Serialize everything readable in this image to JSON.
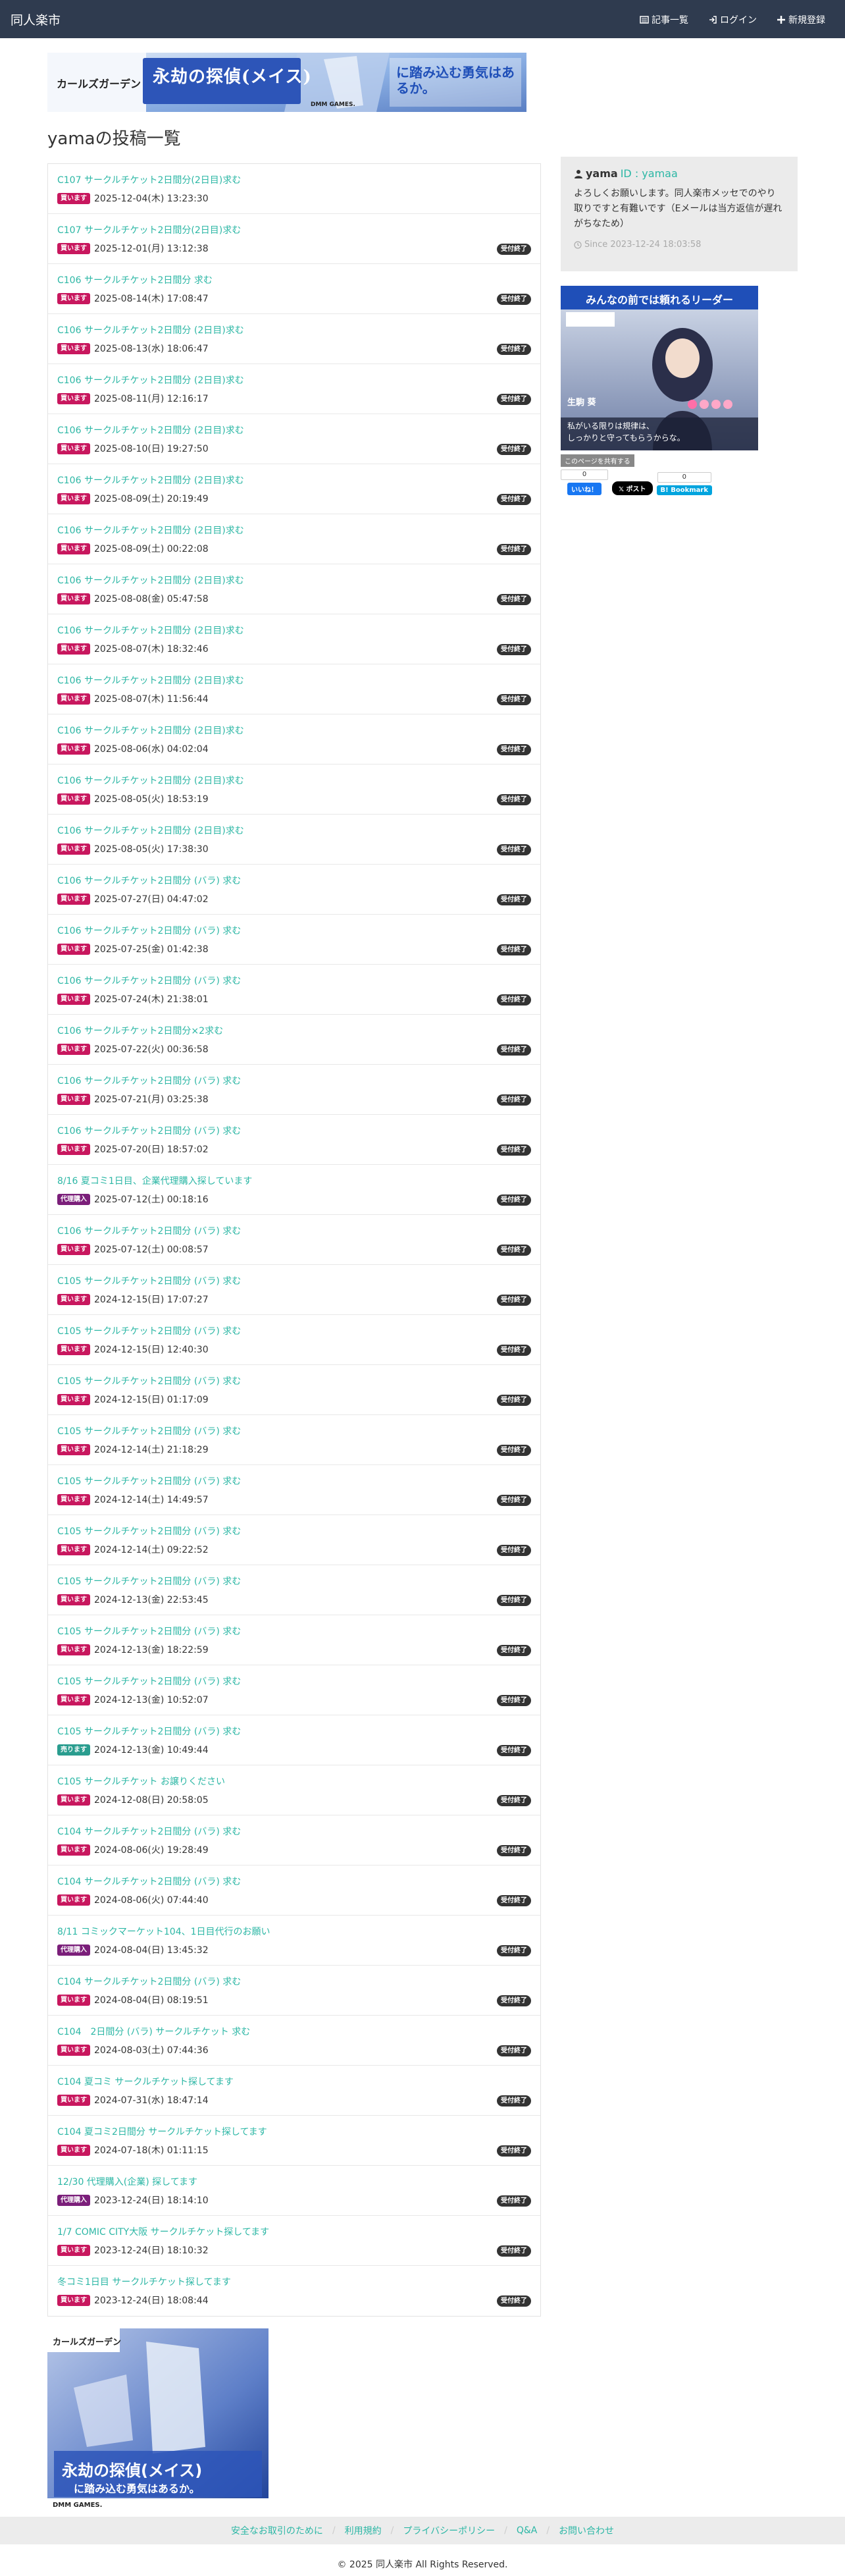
{
  "nav": {
    "brand": "同人楽市",
    "links": [
      {
        "label": "記事一覧",
        "icon": "list-icon"
      },
      {
        "label": "ログイン",
        "icon": "login-icon"
      },
      {
        "label": "新規登録",
        "icon": "plus-icon"
      }
    ]
  },
  "page_title": "yamaの投稿一覧",
  "banner_top": {
    "title_text": "永劫の探偵(メイス)",
    "tagline": "に踏み込む勇気はあるか。",
    "brand": "カールズガーデン",
    "publisher": "DMM GAMES.",
    "colors": {
      "bg": "#7a9fd8",
      "title": "#1f4fb8",
      "logo_bg": "#fff"
    }
  },
  "posts": [
    {
      "title": "C107 サークルチケット2日間分(2日目)求む",
      "type": "買います",
      "date": "2025-12-04(木) 13:23:30",
      "status": ""
    },
    {
      "title": "C107 サークルチケット2日間分(2日目)求む",
      "type": "買います",
      "date": "2025-12-01(月) 13:12:38",
      "status": "受付終了"
    },
    {
      "title": "C106 サークルチケット2日間分 求む",
      "type": "買います",
      "date": "2025-08-14(木) 17:08:47",
      "status": "受付終了"
    },
    {
      "title": "C106 サークルチケット2日間分 (2日目)求む",
      "type": "買います",
      "date": "2025-08-13(水) 18:06:47",
      "status": "受付終了"
    },
    {
      "title": "C106 サークルチケット2日間分 (2日目)求む",
      "type": "買います",
      "date": "2025-08-11(月) 12:16:17",
      "status": "受付終了"
    },
    {
      "title": "C106 サークルチケット2日間分 (2日目)求む",
      "type": "買います",
      "date": "2025-08-10(日) 19:27:50",
      "status": "受付終了"
    },
    {
      "title": "C106 サークルチケット2日間分 (2日目)求む",
      "type": "買います",
      "date": "2025-08-09(土) 20:19:49",
      "status": "受付終了"
    },
    {
      "title": "C106 サークルチケット2日間分 (2日目)求む",
      "type": "買います",
      "date": "2025-08-09(土) 00:22:08",
      "status": "受付終了"
    },
    {
      "title": "C106 サークルチケット2日間分 (2日目)求む",
      "type": "買います",
      "date": "2025-08-08(金) 05:47:58",
      "status": "受付終了"
    },
    {
      "title": "C106 サークルチケット2日間分 (2日目)求む",
      "type": "買います",
      "date": "2025-08-07(木) 18:32:46",
      "status": "受付終了"
    },
    {
      "title": "C106 サークルチケット2日間分 (2日目)求む",
      "type": "買います",
      "date": "2025-08-07(木) 11:56:44",
      "status": "受付終了"
    },
    {
      "title": "C106 サークルチケット2日間分 (2日目)求む",
      "type": "買います",
      "date": "2025-08-06(水) 04:02:04",
      "status": "受付終了"
    },
    {
      "title": "C106 サークルチケット2日間分 (2日目)求む",
      "type": "買います",
      "date": "2025-08-05(火) 18:53:19",
      "status": "受付終了"
    },
    {
      "title": "C106 サークルチケット2日間分 (2日目)求む",
      "type": "買います",
      "date": "2025-08-05(火) 17:38:30",
      "status": "受付終了"
    },
    {
      "title": "C106 サークルチケット2日間分 (バラ) 求む",
      "type": "買います",
      "date": "2025-07-27(日) 04:47:02",
      "status": "受付終了"
    },
    {
      "title": "C106 サークルチケット2日間分 (バラ) 求む",
      "type": "買います",
      "date": "2025-07-25(金) 01:42:38",
      "status": "受付終了"
    },
    {
      "title": "C106 サークルチケット2日間分 (バラ) 求む",
      "type": "買います",
      "date": "2025-07-24(木) 21:38:01",
      "status": "受付終了"
    },
    {
      "title": "C106 サークルチケット2日間分×2求む",
      "type": "買います",
      "date": "2025-07-22(火) 00:36:58",
      "status": "受付終了"
    },
    {
      "title": "C106 サークルチケット2日間分 (バラ) 求む",
      "type": "買います",
      "date": "2025-07-21(月) 03:25:38",
      "status": "受付終了"
    },
    {
      "title": "C106 サークルチケット2日間分 (バラ) 求む",
      "type": "買います",
      "date": "2025-07-20(日) 18:57:02",
      "status": "受付終了"
    },
    {
      "title": "8/16 夏コミ1日目、企業代理購入探しています",
      "type": "代理購入",
      "date": "2025-07-12(土) 00:18:16",
      "status": "受付終了"
    },
    {
      "title": "C106 サークルチケット2日間分 (バラ) 求む",
      "type": "買います",
      "date": "2025-07-12(土) 00:08:57",
      "status": "受付終了"
    },
    {
      "title": "C105 サークルチケット2日間分 (バラ) 求む",
      "type": "買います",
      "date": "2024-12-15(日) 17:07:27",
      "status": "受付終了"
    },
    {
      "title": "C105 サークルチケット2日間分 (バラ) 求む",
      "type": "買います",
      "date": "2024-12-15(日) 12:40:30",
      "status": "受付終了"
    },
    {
      "title": "C105 サークルチケット2日間分 (バラ) 求む",
      "type": "買います",
      "date": "2024-12-15(日) 01:17:09",
      "status": "受付終了"
    },
    {
      "title": "C105 サークルチケット2日間分 (バラ) 求む",
      "type": "買います",
      "date": "2024-12-14(土) 21:18:29",
      "status": "受付終了"
    },
    {
      "title": "C105 サークルチケット2日間分 (バラ) 求む",
      "type": "買います",
      "date": "2024-12-14(土) 14:49:57",
      "status": "受付終了"
    },
    {
      "title": "C105 サークルチケット2日間分 (バラ) 求む",
      "type": "買います",
      "date": "2024-12-14(土) 09:22:52",
      "status": "受付終了"
    },
    {
      "title": "C105 サークルチケット2日間分 (バラ) 求む",
      "type": "買います",
      "date": "2024-12-13(金) 22:53:45",
      "status": "受付終了"
    },
    {
      "title": "C105 サークルチケット2日間分 (バラ) 求む",
      "type": "買います",
      "date": "2024-12-13(金) 18:22:59",
      "status": "受付終了"
    },
    {
      "title": "C105 サークルチケット2日間分 (バラ) 求む",
      "type": "買います",
      "date": "2024-12-13(金) 10:52:07",
      "status": "受付終了"
    },
    {
      "title": "C105 サークルチケット2日間分 (バラ) 求む",
      "type": "売ります",
      "date": "2024-12-13(金) 10:49:44",
      "status": "受付終了"
    },
    {
      "title": "C105 サークルチケット お譲りください",
      "type": "買います",
      "date": "2024-12-08(日) 20:58:05",
      "status": "受付終了"
    },
    {
      "title": "C104 サークルチケット2日間分 (バラ) 求む",
      "type": "買います",
      "date": "2024-08-06(火) 19:28:49",
      "status": "受付終了"
    },
    {
      "title": "C104 サークルチケット2日間分 (バラ) 求む",
      "type": "買います",
      "date": "2024-08-06(火) 07:44:40",
      "status": "受付終了"
    },
    {
      "title": "8/11 コミックマーケット104、1日目代行のお願い",
      "type": "代理購入",
      "date": "2024-08-04(日) 13:45:32",
      "status": "受付終了"
    },
    {
      "title": "C104 サークルチケット2日間分 (バラ) 求む",
      "type": "買います",
      "date": "2024-08-04(日) 08:19:51",
      "status": "受付終了"
    },
    {
      "title": "C104　2日間分 (バラ) サークルチケット 求む",
      "type": "買います",
      "date": "2024-08-03(土) 07:44:36",
      "status": "受付終了"
    },
    {
      "title": "C104 夏コミ サークルチケット探してます",
      "type": "買います",
      "date": "2024-07-31(水) 18:47:14",
      "status": "受付終了"
    },
    {
      "title": "C104 夏コミ2日間分 サークルチケット探してます",
      "type": "買います",
      "date": "2024-07-18(木) 01:11:15",
      "status": "受付終了"
    },
    {
      "title": "12/30 代理購入(企業) 探してます",
      "type": "代理購入",
      "date": "2023-12-24(日) 18:14:10",
      "status": "受付終了"
    },
    {
      "title": "1/7 COMIC CITY大阪 サークルチケット探してます",
      "type": "買います",
      "date": "2023-12-24(日) 18:10:32",
      "status": "受付終了"
    },
    {
      "title": "冬コミ1日目 サークルチケット探してます",
      "type": "買います",
      "date": "2023-12-24(日) 18:08:44",
      "status": "受付終了"
    }
  ],
  "type_colors": {
    "買います": "#c8175e",
    "売ります": "#2a9d8f",
    "代理購入": "#7b1f7a"
  },
  "profile": {
    "name": "yama",
    "id_label": "ID : yamaa",
    "bio": "よろしくお願いします。同人楽市メッセでのやり取りですと有難いです（Eメールは当方返信が遅れがちなため）",
    "since": "Since 2023-12-24 18:03:58"
  },
  "side_ad": {
    "header": "みんなの前では頼れるリーダー",
    "character_name": "生駒 葵",
    "line1": "私がいる限りは規律は、",
    "line2": "しっかりと守ってもらうからな。"
  },
  "share": {
    "label": "このページを共有する",
    "fb_count": "0",
    "fb_label": "いいね！",
    "x_label": "ポスト",
    "hatena_count": "0",
    "hatena_label": "B! Bookmark"
  },
  "footer": {
    "links": [
      "安全なお取引のために",
      "利用規約",
      "プライバシーポリシー",
      "Q&A",
      "お問い合わせ"
    ],
    "copyright": "© 2025 同人楽市 All Rights Reserved."
  }
}
